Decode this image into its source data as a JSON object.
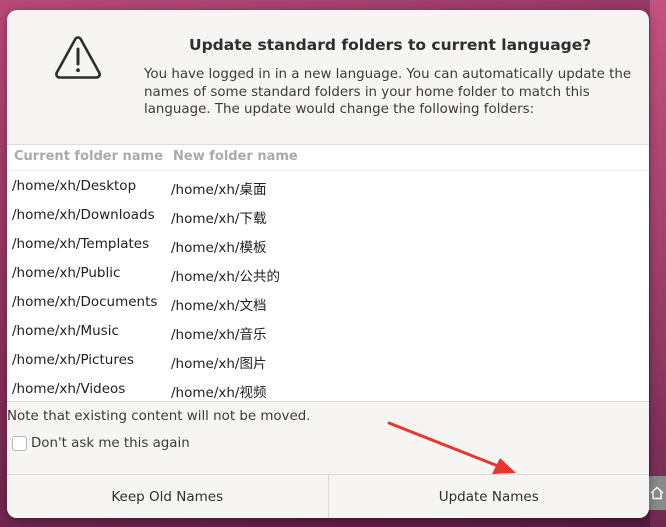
{
  "dialog": {
    "title": "Update standard folders to current language?",
    "message": "You have logged in in a new language. You can automatically update the names of some standard folders in your home folder to match this language. The update would change the following folders:",
    "table": {
      "columns": [
        "Current folder name",
        "New folder name"
      ],
      "rows": [
        [
          "/home/xh/Desktop",
          "/home/xh/桌面"
        ],
        [
          "/home/xh/Downloads",
          "/home/xh/下载"
        ],
        [
          "/home/xh/Templates",
          "/home/xh/模板"
        ],
        [
          "/home/xh/Public",
          "/home/xh/公共的"
        ],
        [
          "/home/xh/Documents",
          "/home/xh/文档"
        ],
        [
          "/home/xh/Music",
          "/home/xh/音乐"
        ],
        [
          "/home/xh/Pictures",
          "/home/xh/图片"
        ],
        [
          "/home/xh/Videos",
          "/home/xh/视频"
        ]
      ]
    },
    "note": "Note that existing content will not be moved.",
    "checkbox_label": "Don't ask me this again",
    "checkbox_checked": false,
    "buttons": {
      "keep": "Keep Old Names",
      "update": "Update Names"
    }
  },
  "annotation": {
    "arrow_color": "#e8372c"
  },
  "icons": {
    "dialog_icon": "warning-icon",
    "background_icon": "home-icon"
  }
}
